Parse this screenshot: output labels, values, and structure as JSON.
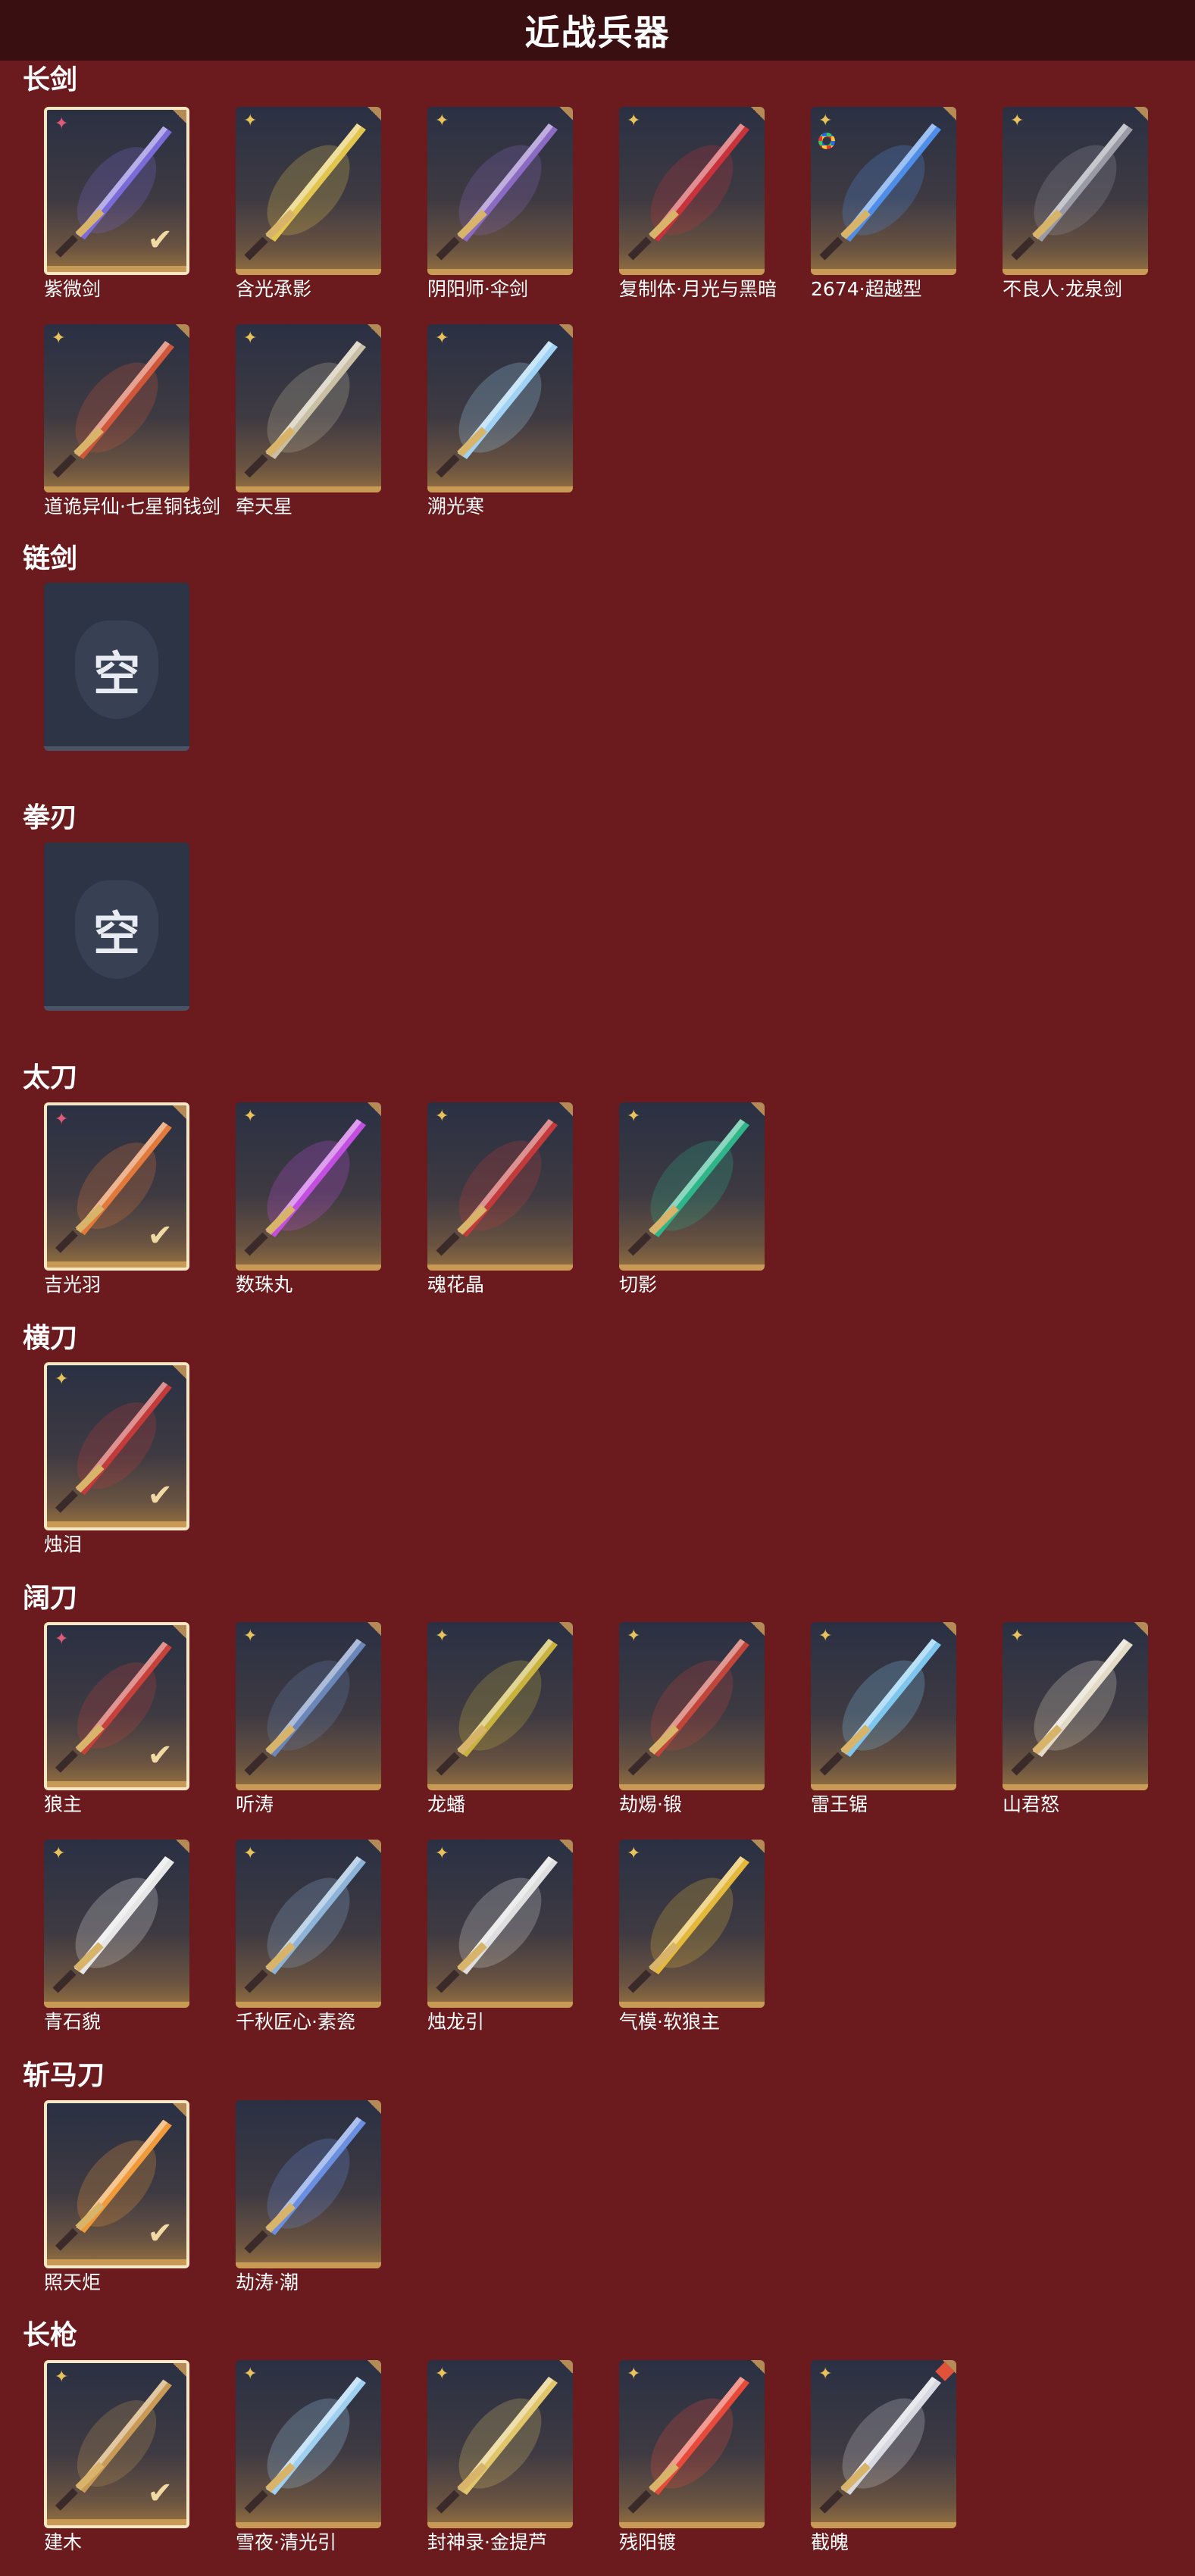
{
  "page_title": "近战兵器",
  "empty_label": "空",
  "colors": {
    "background": "#6b1a1e",
    "topbar": "#3a0f12",
    "card_bottom": "#c99a56",
    "selected_border": "#f5e6c4"
  },
  "sections": [
    {
      "title": "长剑",
      "items": [
        {
          "name": "紫微剑",
          "badge": "pink-star",
          "selected": true,
          "tint": "#7a6bd8"
        },
        {
          "name": "含光承影",
          "badge": "gold-star",
          "selected": false,
          "tint": "#e2c54f"
        },
        {
          "name": "阴阳师·伞剑",
          "badge": "gold-star",
          "selected": false,
          "tint": "#8a6ac2"
        },
        {
          "name": "复制体·月光与黑暗",
          "badge": "gold-star",
          "selected": false,
          "tint": "#c8323a"
        },
        {
          "name": "2674·超越型",
          "badge": "gold-star",
          "secondary_badge": "color-ring",
          "selected": false,
          "tint": "#4f8ee8"
        },
        {
          "name": "不良人·龙泉剑",
          "badge": "gold-star",
          "selected": false,
          "tint": "#9a9aa6"
        },
        {
          "name": "道诡异仙·七星铜钱剑",
          "badge": "gold-star",
          "selected": false,
          "tint": "#d0563a"
        },
        {
          "name": "牵天星",
          "badge": "gold-star",
          "selected": false,
          "tint": "#c9bfa5"
        },
        {
          "name": "溯光寒",
          "badge": "gold-star",
          "selected": false,
          "tint": "#9fd2f5"
        }
      ]
    },
    {
      "title": "链剑",
      "items": [
        {
          "empty": true
        }
      ]
    },
    {
      "title": "拳刃",
      "items": [
        {
          "empty": true
        }
      ]
    },
    {
      "title": "太刀",
      "items": [
        {
          "name": "吉光羽",
          "badge": "pink-star",
          "selected": true,
          "tint": "#e0793a"
        },
        {
          "name": "数珠丸",
          "badge": "gold-star",
          "selected": false,
          "tint": "#c24fe0"
        },
        {
          "name": "魂花晶",
          "badge": "gold-star",
          "selected": false,
          "tint": "#c23a3a"
        },
        {
          "name": "切影",
          "badge": "gold-star",
          "selected": false,
          "tint": "#2fb58a"
        }
      ]
    },
    {
      "title": "横刀",
      "items": [
        {
          "name": "烛泪",
          "badge": "gold-star",
          "selected": true,
          "tint": "#c23a3a"
        }
      ]
    },
    {
      "title": "阔刀",
      "items": [
        {
          "name": "狼主",
          "badge": "pink-star",
          "selected": true,
          "tint": "#c5413a"
        },
        {
          "name": "听涛",
          "badge": "gold-star",
          "selected": false,
          "tint": "#6b86b8"
        },
        {
          "name": "龙蟠",
          "badge": "gold-star",
          "selected": false,
          "tint": "#c9b33f"
        },
        {
          "name": "劫焬·锻",
          "badge": "gold-star",
          "selected": false,
          "tint": "#c2453a"
        },
        {
          "name": "雷王锯",
          "badge": "gold-star",
          "selected": false,
          "tint": "#7ec6ee"
        },
        {
          "name": "山君怒",
          "badge": "gold-star",
          "selected": false,
          "tint": "#e3dbc8"
        },
        {
          "name": "青石貌",
          "badge": "gold-star",
          "selected": false,
          "tint": "#e6e6e6"
        },
        {
          "name": "千秋匠心·素瓷",
          "badge": "gold-star",
          "selected": false,
          "tint": "#8eb3d8"
        },
        {
          "name": "烛龙引",
          "badge": "gold-star",
          "selected": false,
          "tint": "#dedede"
        },
        {
          "name": "气模·软狼主",
          "badge": "gold-star",
          "selected": false,
          "tint": "#e4b83a"
        }
      ]
    },
    {
      "title": "斩马刀",
      "items": [
        {
          "name": "照天炬",
          "badge": "",
          "selected": true,
          "tint": "#f09a3a"
        },
        {
          "name": "劫涛·潮",
          "badge": "",
          "selected": false,
          "tint": "#6a8ee0"
        }
      ]
    },
    {
      "title": "长枪",
      "items": [
        {
          "name": "建木",
          "badge": "gold-star",
          "selected": true,
          "tint": "#c99a56"
        },
        {
          "name": "雪夜·清光引",
          "badge": "gold-star",
          "selected": false,
          "tint": "#9fd0f0"
        },
        {
          "name": "封神录·金提芦",
          "badge": "gold-star",
          "selected": false,
          "tint": "#e0c56a"
        },
        {
          "name": "残阳镀",
          "badge": "gold-star",
          "selected": false,
          "tint": "#e84a3a"
        },
        {
          "name": "截魄",
          "badge": "gold-star",
          "secondary_badge": "red-diamond",
          "selected": false,
          "tint": "#d8d8e0"
        }
      ]
    }
  ]
}
